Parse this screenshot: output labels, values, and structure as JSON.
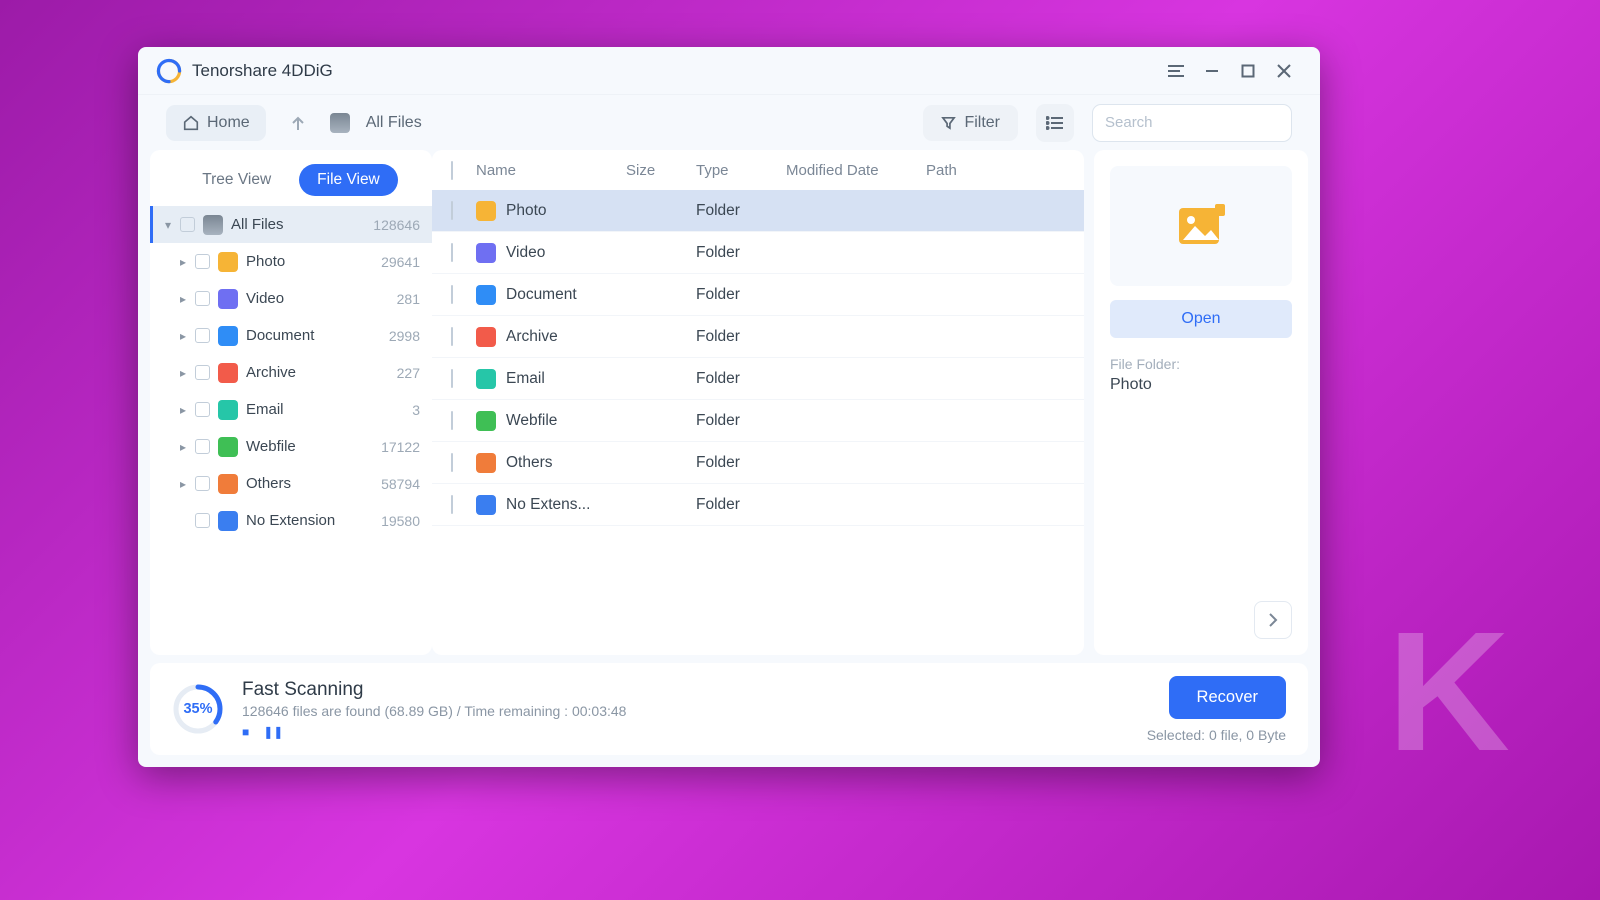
{
  "app": {
    "title": "Tenorshare 4DDiG"
  },
  "toolbar": {
    "home": "Home",
    "breadcrumb": "All Files",
    "filter": "Filter",
    "search_placeholder": "Search"
  },
  "sidebar": {
    "tabs": {
      "tree": "Tree View",
      "file": "File View"
    },
    "root": {
      "label": "All Files",
      "count": "128646"
    },
    "items": [
      {
        "label": "Photo",
        "count": "29641",
        "icon": "ic-photo",
        "caret": true
      },
      {
        "label": "Video",
        "count": "281",
        "icon": "ic-video",
        "caret": true
      },
      {
        "label": "Document",
        "count": "2998",
        "icon": "ic-doc",
        "caret": true
      },
      {
        "label": "Archive",
        "count": "227",
        "icon": "ic-archive",
        "caret": true
      },
      {
        "label": "Email",
        "count": "3",
        "icon": "ic-email",
        "caret": true
      },
      {
        "label": "Webfile",
        "count": "17122",
        "icon": "ic-web",
        "caret": true
      },
      {
        "label": "Others",
        "count": "58794",
        "icon": "ic-others",
        "caret": true
      },
      {
        "label": "No Extension",
        "count": "19580",
        "icon": "ic-noext",
        "caret": false
      }
    ]
  },
  "table": {
    "headers": {
      "name": "Name",
      "size": "Size",
      "type": "Type",
      "mod": "Modified Date",
      "path": "Path"
    },
    "rows": [
      {
        "name": "Photo",
        "type": "Folder",
        "icon": "ic-photo",
        "selected": true
      },
      {
        "name": "Video",
        "type": "Folder",
        "icon": "ic-video",
        "selected": false
      },
      {
        "name": "Document",
        "type": "Folder",
        "icon": "ic-doc",
        "selected": false
      },
      {
        "name": "Archive",
        "type": "Folder",
        "icon": "ic-archive",
        "selected": false
      },
      {
        "name": "Email",
        "type": "Folder",
        "icon": "ic-email",
        "selected": false
      },
      {
        "name": "Webfile",
        "type": "Folder",
        "icon": "ic-web",
        "selected": false
      },
      {
        "name": "Others",
        "type": "Folder",
        "icon": "ic-others",
        "selected": false
      },
      {
        "name": "No Extens...",
        "type": "Folder",
        "icon": "ic-noext",
        "selected": false
      }
    ]
  },
  "preview": {
    "open": "Open",
    "meta_label": "File Folder:",
    "meta_value": "Photo"
  },
  "footer": {
    "progress_pct": "35%",
    "progress_val": 35,
    "title": "Fast Scanning",
    "sub": "128646 files are found (68.89 GB) /  Time remaining : 00:03:48",
    "recover": "Recover",
    "selected": "Selected: 0 file, 0 Byte"
  }
}
